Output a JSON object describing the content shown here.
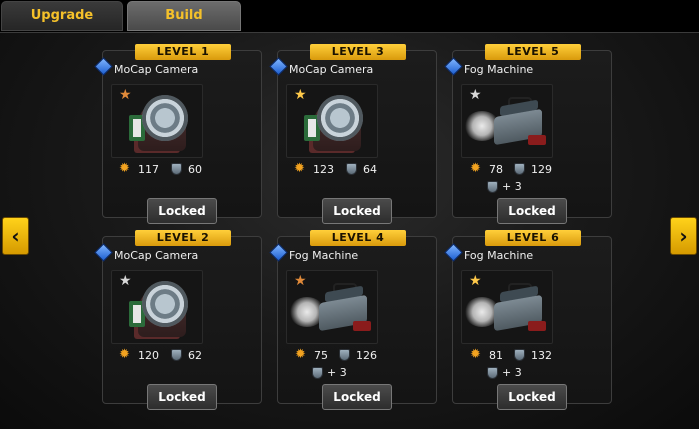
{
  "tabs": [
    {
      "label": "Upgrade",
      "active": false
    },
    {
      "label": "Build",
      "active": true
    }
  ],
  "nav": {
    "left_icon": "chevron-left-icon",
    "right_icon": "chevron-right-icon"
  },
  "colors": {
    "accent_gold": "#f5c12a",
    "ribbon": "#ffcf3a",
    "gem_blue": "#1d5fd0"
  },
  "cards": [
    {
      "level": "LEVEL 1",
      "name": "MoCap Camera",
      "star": "bronze",
      "image": "camera",
      "power": "117",
      "defense": "60",
      "extra": "",
      "button": "Locked"
    },
    {
      "level": "LEVEL 3",
      "name": "MoCap Camera",
      "star": "gold",
      "image": "camera",
      "power": "123",
      "defense": "64",
      "extra": "",
      "button": "Locked"
    },
    {
      "level": "LEVEL 5",
      "name": "Fog Machine",
      "star": "silver",
      "image": "fog",
      "power": "78",
      "defense": "129",
      "extra": "+ 3",
      "button": "Locked"
    },
    {
      "level": "LEVEL 2",
      "name": "MoCap Camera",
      "star": "silver",
      "image": "camera",
      "power": "120",
      "defense": "62",
      "extra": "",
      "button": "Locked"
    },
    {
      "level": "LEVEL 4",
      "name": "Fog Machine",
      "star": "bronze",
      "image": "fog",
      "power": "75",
      "defense": "126",
      "extra": "+ 3",
      "button": "Locked"
    },
    {
      "level": "LEVEL 6",
      "name": "Fog Machine",
      "star": "gold",
      "image": "fog",
      "power": "81",
      "defense": "132",
      "extra": "+ 3",
      "button": "Locked"
    }
  ]
}
